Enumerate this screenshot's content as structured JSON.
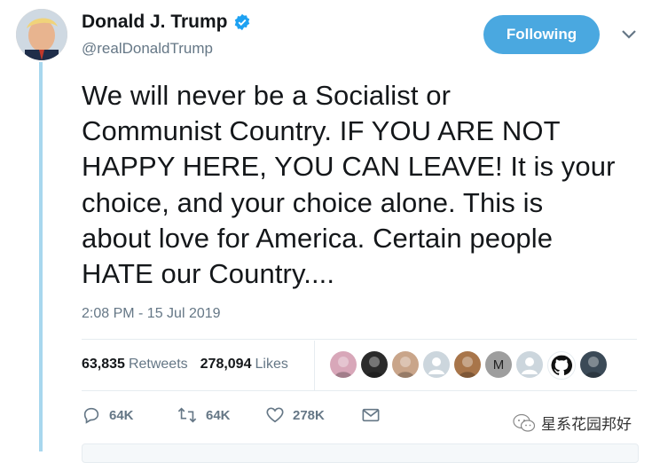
{
  "author": {
    "name": "Donald J. Trump",
    "handle": "@realDonaldTrump",
    "verified": true
  },
  "follow_button": {
    "label": "Following",
    "color": "#4aa8e0"
  },
  "tweet": {
    "text": "We will never be a Socialist or\nCommunist Country. IF YOU ARE NOT\nHAPPY HERE, YOU CAN LEAVE! It is your\nchoice, and your choice alone. This is\nabout love for America. Certain people\nHATE our Country....",
    "timestamp": "2:08 PM - 15 Jul 2019"
  },
  "stats": {
    "retweets_count": "63,835",
    "retweets_label": "Retweets",
    "likes_count": "278,094",
    "likes_label": "Likes"
  },
  "liker_avatars": [
    {
      "kind": "photo",
      "color": "#d8a7b9"
    },
    {
      "kind": "photo",
      "color": "#2b2b2b"
    },
    {
      "kind": "photo",
      "color": "#c9a58a"
    },
    {
      "kind": "default",
      "color": "#ccd6dd"
    },
    {
      "kind": "photo",
      "color": "#a8754a"
    },
    {
      "kind": "letter",
      "color": "#9e9e9e",
      "letter": "M"
    },
    {
      "kind": "default",
      "color": "#ccd6dd"
    },
    {
      "kind": "github",
      "color": "#ffffff"
    },
    {
      "kind": "photo",
      "color": "#3b4a57"
    }
  ],
  "actions": {
    "reply_count": "64K",
    "retweet_count": "64K",
    "like_count": "278K"
  },
  "watermark": {
    "text": "星系花园邦好"
  },
  "colors": {
    "accent": "#1da1f2",
    "thread_line": "#a8d7ee",
    "muted": "#657786"
  }
}
